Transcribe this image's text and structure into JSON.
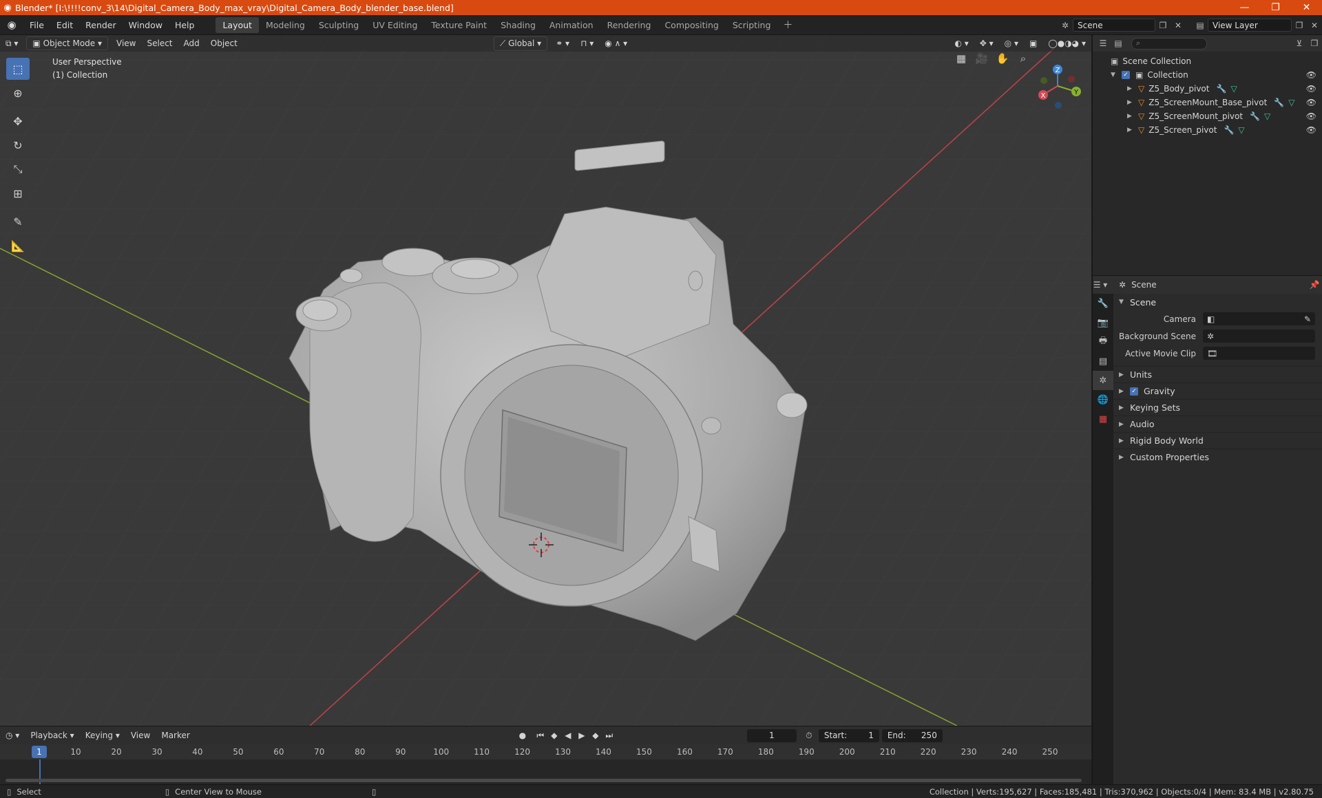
{
  "window": {
    "title": "Blender* [I:\\!!!!conv_3\\14\\Digital_Camera_Body_max_vray\\Digital_Camera_Body_blender_base.blend]",
    "controls": [
      "—",
      "❐",
      "✕"
    ]
  },
  "menu": [
    "File",
    "Edit",
    "Render",
    "Window",
    "Help"
  ],
  "workspaces": [
    "Layout",
    "Modeling",
    "Sculpting",
    "UV Editing",
    "Texture Paint",
    "Shading",
    "Animation",
    "Rendering",
    "Compositing",
    "Scripting"
  ],
  "active_workspace": "Layout",
  "scene_selector": "Scene",
  "view_layer_selector": "View Layer",
  "viewport": {
    "mode": "Object Mode",
    "menus": [
      "View",
      "Select",
      "Add",
      "Object"
    ],
    "transform_orientation": "Global",
    "overlay_text": [
      "User Perspective",
      "(1) Collection"
    ],
    "gizmo_axes": {
      "x": "X",
      "y": "Y",
      "z": "Z"
    },
    "colors": {
      "x_axis": "#d24a55",
      "y_axis": "#88b12d",
      "z_axis": "#3f86d6",
      "accent": "#4772b3"
    }
  },
  "toolbar_tools": [
    "select-box",
    "cursor",
    "move",
    "rotate",
    "scale",
    "transform",
    "annotate",
    "measure"
  ],
  "outliner": {
    "root": "Scene Collection",
    "collection": "Collection",
    "objects": [
      "Z5_Body_pivot",
      "Z5_ScreenMount_Base_pivot",
      "Z5_ScreenMount_pivot",
      "Z5_Screen_pivot"
    ]
  },
  "properties": {
    "context": "Scene",
    "panel": "Scene",
    "fields": [
      {
        "label": "Camera",
        "value": ""
      },
      {
        "label": "Background Scene",
        "value": ""
      },
      {
        "label": "Active Movie Clip",
        "value": ""
      }
    ],
    "subpanels": [
      "Units",
      "Gravity",
      "Keying Sets",
      "Audio",
      "Rigid Body World",
      "Custom Properties"
    ],
    "gravity_checked": true
  },
  "timeline": {
    "menus": [
      "Playback",
      "Keying",
      "View",
      "Marker"
    ],
    "current_frame": "1",
    "start_label": "Start:",
    "start": "1",
    "end_label": "End:",
    "end": "250",
    "ticks": [
      "10",
      "20",
      "30",
      "40",
      "50",
      "60",
      "70",
      "80",
      "90",
      "100",
      "110",
      "120",
      "130",
      "140",
      "150",
      "160",
      "170",
      "180",
      "190",
      "200",
      "210",
      "220",
      "230",
      "240",
      "250"
    ]
  },
  "statusbar": {
    "left_action": "Select",
    "middle_action": "Center View to Mouse",
    "stats": "Collection | Verts:195,627 | Faces:185,481 | Tris:370,962 | Objects:0/4 | Mem: 83.4 MB | v2.80.75"
  }
}
